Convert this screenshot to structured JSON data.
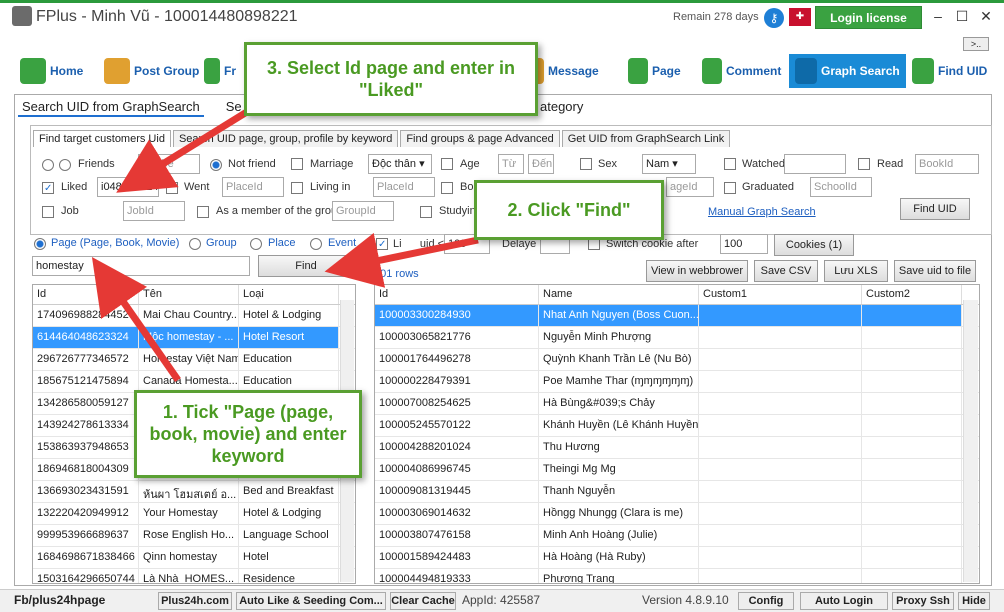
{
  "window": {
    "title": "FPlus - Minh Vũ - 100014480898221",
    "remain": "Remain 278 days",
    "login_license": "Login license",
    "more": ">.."
  },
  "toolbar": {
    "home": "Home",
    "post_group": "Post Group",
    "friends": "Fr",
    "message": "Message",
    "page": "Page",
    "comment": "Comment",
    "graph_search": "Graph Search",
    "find_uid": "Find UID"
  },
  "tabs_top": [
    "Search UID from GraphSearch",
    "Se",
    "ategory"
  ],
  "tabs_inner": [
    "Find target customers Uid",
    "Search UID page, group, profile by keyword",
    "Find groups & page Advanced",
    "Get UID from GraphSearch Link"
  ],
  "filters": {
    "friends": "Friends",
    "uid_ph": "Uid bè",
    "not_friend": "Not friend",
    "marriage": "Marriage",
    "marriage_val": "Độc thân",
    "age": "Age",
    "age_from": "Từ",
    "age_to": "Đến",
    "sex": "Sex",
    "sex_val": "Nam",
    "watched": "Watched",
    "read": "Read",
    "book_ph": "BookId",
    "liked": "Liked",
    "liked_val": "i048623324",
    "went": "Went",
    "place_ph": "PlaceId",
    "living": "Living in",
    "born": "Bor",
    "place_ph2": "ageId",
    "graduated": "Graduated",
    "school_ph": "SchoolId",
    "job": "Job",
    "job_ph": "JobId",
    "member": "As a member of the group",
    "group_ph": "GroupId",
    "studying": "Studyin",
    "manual": "Manual Graph Search",
    "find_uid": "Find UID"
  },
  "search": {
    "opt_page": "Page (Page, Book, Movie)",
    "opt_group": "Group",
    "opt_place": "Place",
    "opt_event": "Event",
    "limit_label": "Li      uid <",
    "limit_val": "100",
    "delay_label": "Delaye",
    "switch": "Switch cookie after",
    "switch_val": "100",
    "cookies": "Cookies (1)",
    "keyword": "homestay",
    "find": "Find"
  },
  "results": {
    "rows": "101 rows",
    "view": "View in webbrower",
    "save_csv": "Save CSV",
    "save_xls": "Lưu XLS",
    "save_file": "Save uid to file"
  },
  "left_grid": {
    "cols": [
      "Id",
      "Tên",
      "Loại"
    ],
    "rows": [
      [
        "1740969882844524",
        "Mai Chau Country...",
        "Hotel & Lodging"
      ],
      [
        "614464048623324",
        "Mộc homestay - ...",
        "Hotel Resort"
      ],
      [
        "296726777346572",
        "Homestay Việt Nam",
        "Education"
      ],
      [
        "185675121475894",
        "Canada Homesta...",
        "Education"
      ],
      [
        "134286580059127",
        "",
        ""
      ],
      [
        "143924278613334",
        "",
        ""
      ],
      [
        "153863937948653",
        "",
        ""
      ],
      [
        "186946818004309",
        "",
        ""
      ],
      [
        "136693023431591",
        "ห้นผา โฮมสเตย์ อ...",
        "Bed and Breakfast"
      ],
      [
        "132220420949912",
        "Your Homestay",
        "Hotel & Lodging"
      ],
      [
        "999953966689637",
        "Rose English Ho...",
        "Language School"
      ],
      [
        "1684698671838466",
        "Qinn homestay",
        "Hotel"
      ],
      [
        "1503164296650744",
        "Là Nhà_HOMES...",
        "Residence"
      ]
    ]
  },
  "right_grid": {
    "cols": [
      "Id",
      "Name",
      "Custom1",
      "Custom2"
    ],
    "rows": [
      [
        "100003300284930",
        "Nhat Anh Nguyen (Boss Cuon..."
      ],
      [
        "100003065821776",
        "Nguyễn Minh Phượng"
      ],
      [
        "100001764496278",
        "Quỳnh Khanh Trần Lê (Nu Bò)"
      ],
      [
        "100000228479391",
        "Poe Mamhe Thar (ɱɱɱɱɱɱ)"
      ],
      [
        "100007008254625",
        "Hà Bùng&#039;s Chảy"
      ],
      [
        "100005245570122",
        "Khánh Huyền (Lê Khánh Huyền)"
      ],
      [
        "100004288201024",
        "Thu Hương"
      ],
      [
        "100004086996745",
        "Theingi Mg Mg"
      ],
      [
        "100009081319445",
        "Thanh Nguyễn"
      ],
      [
        "100003069014632",
        "Hồngg Nhungg (Clara is me)"
      ],
      [
        "100003807476158",
        "Minh Anh Hoàng (Julie)"
      ],
      [
        "100001589424483",
        "Hà Hoàng (Hà Ruby)"
      ],
      [
        "100004494819333",
        "Phương Trang"
      ]
    ]
  },
  "status": {
    "link": "Fb/plus24hpage",
    "plus24h": "Plus24h.com",
    "auto_like": "Auto Like & Seeding Com...",
    "clear_cache": "Clear Cache",
    "appid": "AppId: 425587",
    "version": "Version 4.8.9.10",
    "config": "Config",
    "auto_login": "Auto Login",
    "proxy": "Proxy Ssh",
    "hide": "Hide"
  },
  "callouts": {
    "c1": "1. Tick \"Page (page, book, movie) and enter keyword",
    "c2": "2. Click \"Find\"",
    "c3": "3. Select Id page and enter in \"Liked\""
  }
}
